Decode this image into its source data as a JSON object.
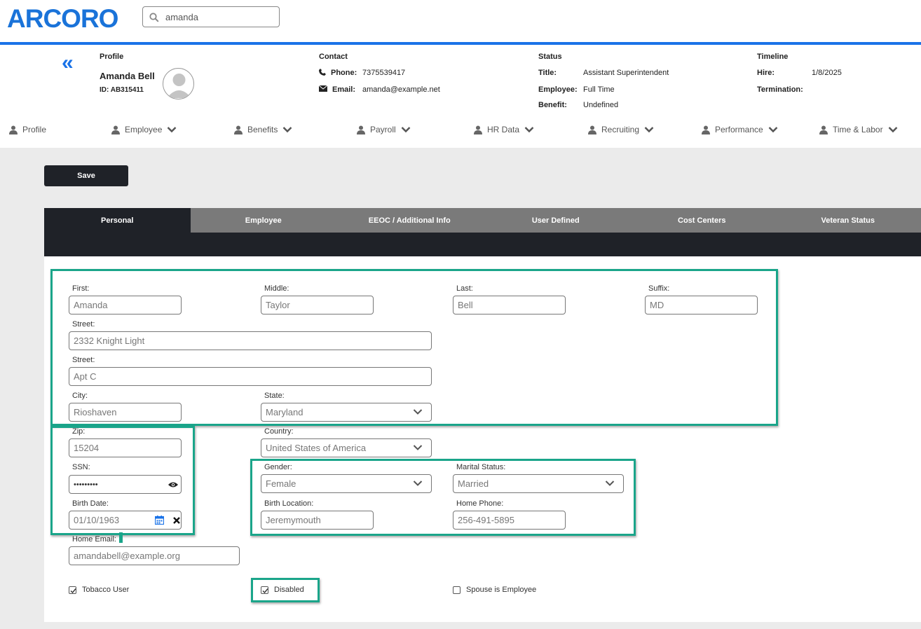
{
  "app": {
    "logo": "ARCORO"
  },
  "search": {
    "value": "amanda",
    "placeholder": ""
  },
  "profile": {
    "label": "Profile",
    "name": "Amanda Bell",
    "id": "ID: AB315411"
  },
  "contact": {
    "label": "Contact",
    "phone_label": "Phone:",
    "phone": "7375539417",
    "email_label": "Email:",
    "email": "amanda@example.net"
  },
  "status": {
    "label": "Status",
    "title_label": "Title:",
    "title": "Assistant Superintendent",
    "employee_label": "Employee:",
    "employee": "Full Time",
    "benefit_label": "Benefit:",
    "benefit": "Undefined"
  },
  "timeline": {
    "label": "Timeline",
    "hire_label": "Hire:",
    "hire": "1/8/2025",
    "termination_label": "Termination:"
  },
  "nav": [
    "Profile",
    "Employee",
    "Benefits",
    "Payroll",
    "HR Data",
    "Recruiting",
    "Performance",
    "Time & Labor"
  ],
  "toolbar": {
    "save_label": "Save"
  },
  "tabs": [
    "Personal",
    "Employee",
    "EEOC / Additional Info",
    "User Defined",
    "Cost Centers",
    "Veteran Status"
  ],
  "form": {
    "first": {
      "label": "First:",
      "value": "Amanda"
    },
    "middle": {
      "label": "Middle:",
      "value": "Taylor"
    },
    "last": {
      "label": "Last:",
      "value": "Bell"
    },
    "suffix": {
      "label": "Suffix:",
      "value": "MD"
    },
    "street1": {
      "label": "Street:",
      "value": "2332 Knight Light"
    },
    "street2": {
      "label": "Street:",
      "value": "Apt C"
    },
    "city": {
      "label": "City:",
      "value": "Rioshaven"
    },
    "state": {
      "label": "State:",
      "value": "Maryland"
    },
    "zip": {
      "label": "Zip:",
      "value": "15204"
    },
    "country": {
      "label": "Country:",
      "value": "United States of America"
    },
    "ssn": {
      "label": "SSN:",
      "value": "•••••••••"
    },
    "gender": {
      "label": "Gender:",
      "value": "Female"
    },
    "marital": {
      "label": "Marital Status:",
      "value": "Married"
    },
    "birth_date": {
      "label": "Birth Date:",
      "value": "01/10/1963"
    },
    "birth_location": {
      "label": "Birth Location:",
      "value": "Jeremymouth"
    },
    "home_phone": {
      "label": "Home Phone:",
      "value": "256-491-5895"
    },
    "home_email": {
      "label": "Home Email:",
      "value": "amandabell@example.org"
    },
    "tobacco": {
      "label": "Tobacco User",
      "checked": true
    },
    "disabled": {
      "label": "Disabled",
      "checked": true
    },
    "spouse": {
      "label": "Spouse is Employee",
      "checked": false
    }
  },
  "colors": {
    "brand": "#1a73e8",
    "highlight": "#1aa58a",
    "dark": "#1f2228"
  }
}
